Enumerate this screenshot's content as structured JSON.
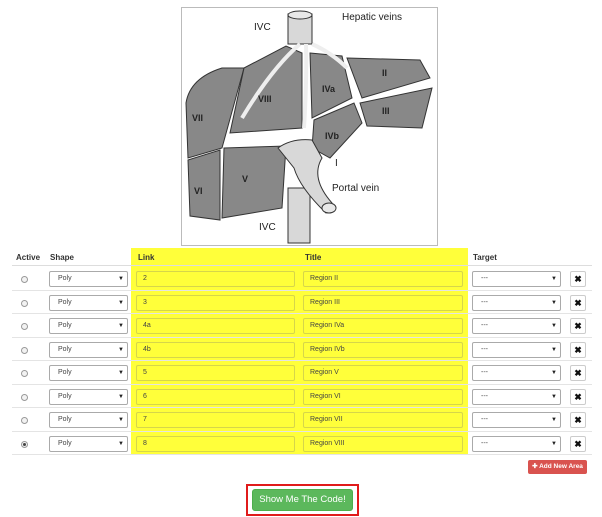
{
  "figure": {
    "labels": {
      "ivc_top": "IVC",
      "hepatic": "Hepatic veins",
      "ivc_bottom": "IVC",
      "portal": "Portal vein",
      "seg_I": "I",
      "seg_II": "II",
      "seg_III": "III",
      "seg_IVa": "IVa",
      "seg_IVb": "IVb",
      "seg_V": "V",
      "seg_VI": "VI",
      "seg_VII": "VII",
      "seg_VIII": "VIII"
    }
  },
  "table": {
    "headers": {
      "active": "Active",
      "shape": "Shape",
      "link": "Link",
      "title": "Title",
      "target": "Target"
    },
    "rows": [
      {
        "active": false,
        "shape": "Poly",
        "link": "2",
        "title": "Region II",
        "target": "---"
      },
      {
        "active": false,
        "shape": "Poly",
        "link": "3",
        "title": "Region III",
        "target": "---"
      },
      {
        "active": false,
        "shape": "Poly",
        "link": "4a",
        "title": "Region IVa",
        "target": "---"
      },
      {
        "active": false,
        "shape": "Poly",
        "link": "4b",
        "title": "Region IVb",
        "target": "---"
      },
      {
        "active": false,
        "shape": "Poly",
        "link": "5",
        "title": "Region V",
        "target": "---"
      },
      {
        "active": false,
        "shape": "Poly",
        "link": "6",
        "title": "Region VI",
        "target": "---"
      },
      {
        "active": false,
        "shape": "Poly",
        "link": "7",
        "title": "Region VII",
        "target": "---"
      },
      {
        "active": true,
        "shape": "Poly",
        "link": "8",
        "title": "Region VIII",
        "target": "---"
      }
    ]
  },
  "buttons": {
    "add_new_area": "Add New Area",
    "show_code": "Show Me The Code!"
  },
  "colors": {
    "highlight": "#ffff3a",
    "add_button": "#d9534f",
    "show_button": "#5cb85c",
    "show_button_outline": "#e01b1b"
  },
  "icons": {
    "delete": "close-icon",
    "add": "plus-icon",
    "select": "caret-down-icon"
  }
}
